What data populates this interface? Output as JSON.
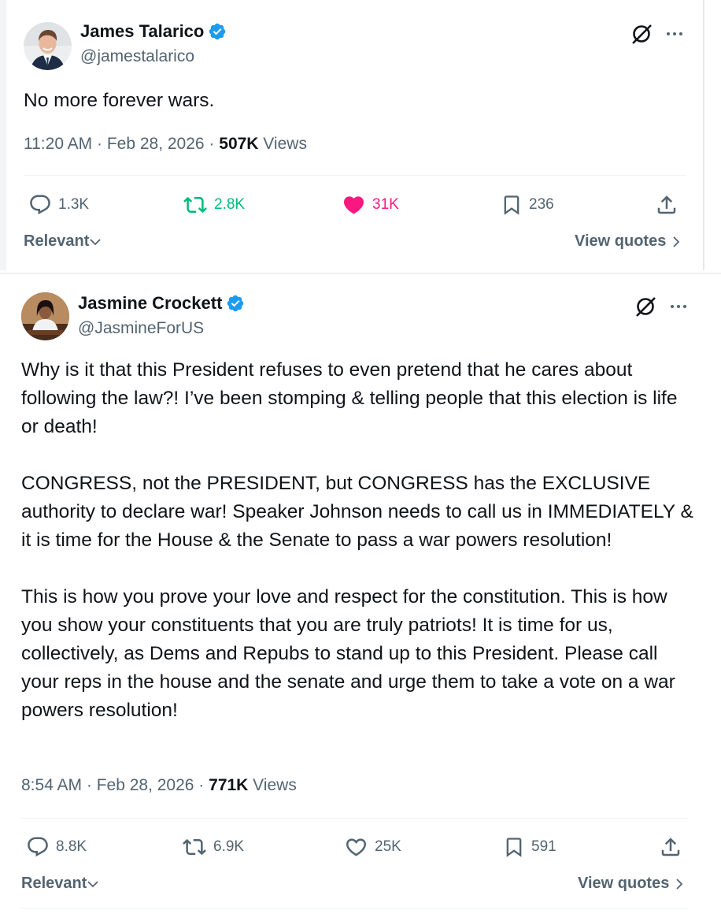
{
  "tweets": [
    {
      "name": "James Talarico",
      "handle": "@jamestalarico",
      "text": "No more forever wars.",
      "time": "11:20 AM · Feb 28, 2026 · ",
      "views_count": "507K",
      "views_label": " Views",
      "replies": "1.3K",
      "reposts": "2.8K",
      "likes": "31K",
      "bookmarks": "236",
      "liked": true,
      "reposted": true,
      "relevant_label": "Relevant",
      "view_quotes_label": "View quotes"
    },
    {
      "name": "Jasmine Crockett",
      "handle": "@JasmineForUS",
      "text": "Why is it that this President refuses to even pretend that he cares about following the law?! I’ve been stomping & telling people that this election is life or death!\n\nCONGRESS, not the PRESIDENT, but CONGRESS has the EXCLUSIVE authority to declare war! Speaker Johnson needs to call us in IMMEDIATELY & it is time for the House & the Senate to pass a war powers resolution!\n\nThis is how you prove your love and respect for the constitution. This is how you show your constituents that you are truly patriots! It is time for us, collectively, as Dems and Repubs to stand up to this President. Please call your reps in the house and the senate and urge them to take a vote on a war powers resolution!",
      "time": "8:54 AM · Feb 28, 2026 · ",
      "views_count": "771K",
      "views_label": " Views",
      "replies": "8.8K",
      "reposts": "6.9K",
      "likes": "25K",
      "bookmarks": "591",
      "liked": false,
      "reposted": false,
      "relevant_label": "Relevant",
      "view_quotes_label": "View quotes"
    }
  ],
  "colors": {
    "verified": "#1d9bf0",
    "repost_active": "#00ba7c",
    "like_active": "#f91880",
    "secondary_text": "#536471"
  }
}
